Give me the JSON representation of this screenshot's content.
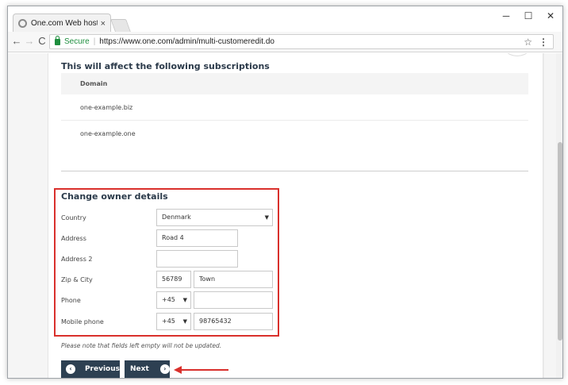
{
  "browser": {
    "tab_title": "One.com Web hosting",
    "tab_close": "×",
    "minimize": "─",
    "maximize": "☐",
    "close": "✕",
    "back": "←",
    "forward": "→",
    "reload": "C",
    "secure_label": "Secure",
    "url": "https://www.one.com/admin/multi-customeredit.do",
    "star": "☆",
    "menu": "⋮"
  },
  "subscriptions": {
    "title": "This will affect the following subscriptions",
    "column_header": "Domain",
    "domains": [
      "one-example.biz",
      "one-example.one"
    ]
  },
  "owner_form": {
    "title": "Change owner details",
    "country_label": "Country",
    "country_value": "Denmark",
    "address_label": "Address",
    "address_value": "Road 4",
    "address2_label": "Address 2",
    "address2_value": "",
    "zip_city_label": "Zip & City",
    "zip_value": "56789",
    "city_value": "Town",
    "phone_label": "Phone",
    "phone_code": "+45",
    "phone_value": "",
    "mobile_label": "Mobile phone",
    "mobile_code": "+45",
    "mobile_value": "98765432",
    "select_arrow": "▼"
  },
  "note": "Please note that fields left empty will not be updated.",
  "buttons": {
    "previous_label": "Previous",
    "next_label": "Next",
    "previous_icon": "‹",
    "next_icon": "›"
  },
  "colors": {
    "accent": "#2d4052",
    "highlight": "#d9302c",
    "secure": "#1e8e3e"
  }
}
